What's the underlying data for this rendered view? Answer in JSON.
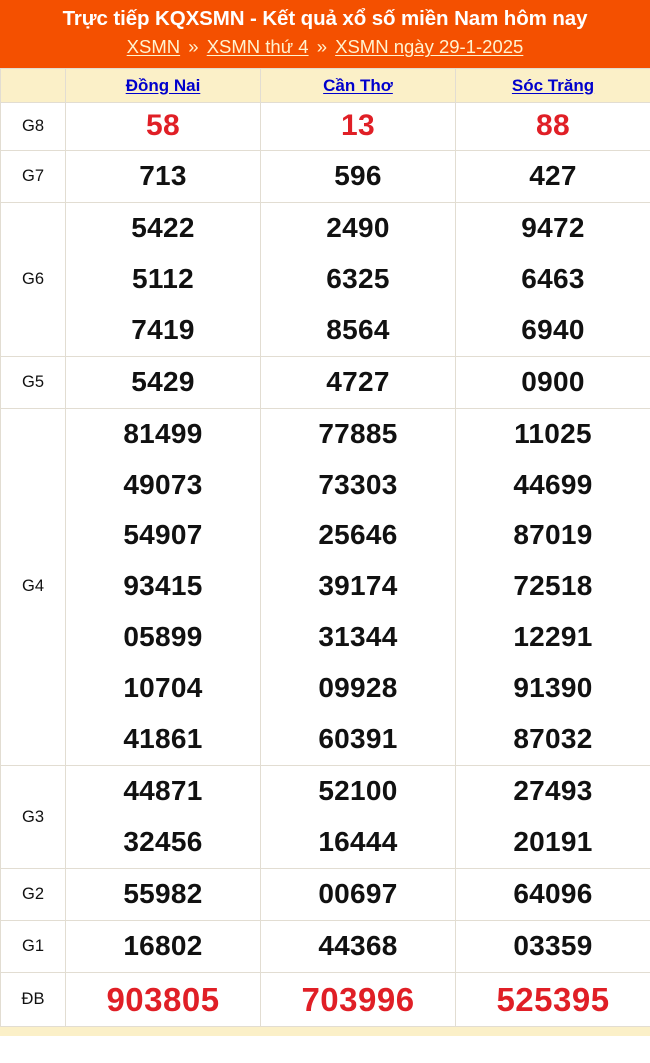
{
  "banner": {
    "title": "Trực tiếp KQXSMN - Kết quả xổ số miền Nam hôm nay",
    "breadcrumb": [
      {
        "label": "XSMN",
        "type": "link"
      },
      {
        "label": "»",
        "type": "separator"
      },
      {
        "label": "XSMN thứ 4",
        "type": "link"
      },
      {
        "label": "»",
        "type": "separator"
      },
      {
        "label": "XSMN ngày 29-1-2025",
        "type": "link"
      }
    ]
  },
  "table": {
    "corner_label": "",
    "provinces": [
      "Đồng Nai",
      "Cần Thơ",
      "Sóc Trăng"
    ],
    "rows": [
      {
        "prize": "G8",
        "style": "red-g8",
        "values": [
          [
            "58"
          ],
          [
            "13"
          ],
          [
            "88"
          ]
        ]
      },
      {
        "prize": "G7",
        "style": "normal",
        "values": [
          [
            "713"
          ],
          [
            "596"
          ],
          [
            "427"
          ]
        ]
      },
      {
        "prize": "G6",
        "style": "normal",
        "values": [
          [
            "5422",
            "5112",
            "7419"
          ],
          [
            "2490",
            "6325",
            "8564"
          ],
          [
            "9472",
            "6463",
            "6940"
          ]
        ]
      },
      {
        "prize": "G5",
        "style": "normal",
        "values": [
          [
            "5429"
          ],
          [
            "4727"
          ],
          [
            "0900"
          ]
        ]
      },
      {
        "prize": "G4",
        "style": "normal",
        "values": [
          [
            "81499",
            "49073",
            "54907",
            "93415",
            "05899",
            "10704",
            "41861"
          ],
          [
            "77885",
            "73303",
            "25646",
            "39174",
            "31344",
            "09928",
            "60391"
          ],
          [
            "11025",
            "44699",
            "87019",
            "72518",
            "12291",
            "91390",
            "87032"
          ]
        ]
      },
      {
        "prize": "G3",
        "style": "normal",
        "values": [
          [
            "44871",
            "32456"
          ],
          [
            "52100",
            "16444"
          ],
          [
            "27493",
            "20191"
          ]
        ]
      },
      {
        "prize": "G2",
        "style": "normal",
        "values": [
          [
            "55982"
          ],
          [
            "00697"
          ],
          [
            "64096"
          ]
        ]
      },
      {
        "prize": "G1",
        "style": "normal",
        "values": [
          [
            "16802"
          ],
          [
            "44368"
          ],
          [
            "03359"
          ]
        ]
      },
      {
        "prize": "ĐB",
        "style": "red-db",
        "values": [
          [
            "903805"
          ],
          [
            "703996"
          ],
          [
            "525395"
          ]
        ]
      }
    ]
  },
  "colors": {
    "banner_bg": "#F45000",
    "header_row_bg": "#FBF0C8",
    "province_link": "#0000CC",
    "highlight_red": "#E01F26",
    "grid_line": "#E2DDD2",
    "text": "#111111"
  }
}
